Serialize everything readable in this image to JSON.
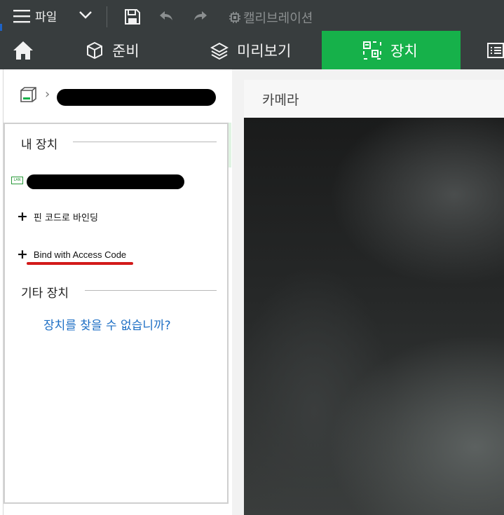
{
  "toolbar": {
    "file_label": "파일",
    "calibration_label": "캘리브레이션"
  },
  "nav": {
    "tabs": [
      {
        "label": "준비",
        "icon": "cube-icon"
      },
      {
        "label": "미리보기",
        "icon": "layers-icon"
      },
      {
        "label": "장치",
        "icon": "device-icon",
        "active": true
      }
    ],
    "accent_color": "#16b14a"
  },
  "sidebar": {
    "my_devices_title": "내 장치",
    "lan_badge": "LAN",
    "bind_pin_label": "핀 코드로 바인딩",
    "bind_access_label": "Bind with Access Code",
    "other_devices_title": "기타 장치",
    "cant_find_link": "장치를 찾을 수 없습니까?"
  },
  "camera": {
    "title": "카메라"
  }
}
